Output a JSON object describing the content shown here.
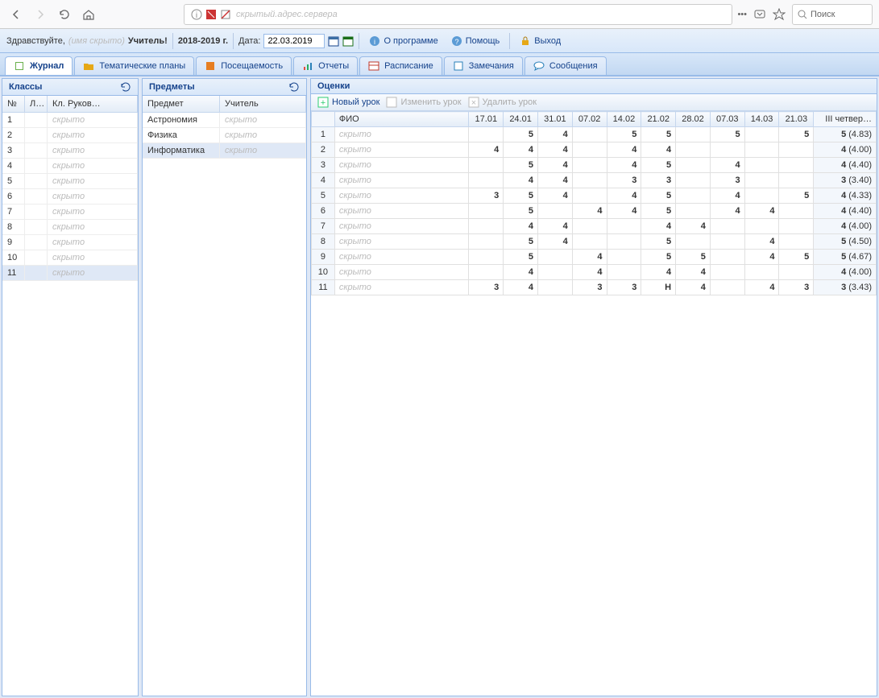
{
  "browser": {
    "url_display": "",
    "search_placeholder": "Поиск"
  },
  "toolbar": {
    "greeting": "Здравствуйте,",
    "user_placeholder": "(имя скрыто)",
    "role": "Учитель!",
    "year": "2018-2019 г.",
    "date_label": "Дата:",
    "date_value": "22.03.2019",
    "about": "О программе",
    "help": "Помощь",
    "exit": "Выход"
  },
  "tabs": [
    "Журнал",
    "Тематические планы",
    "Посещаемость",
    "Отчеты",
    "Расписание",
    "Замечания",
    "Сообщения"
  ],
  "classes_title": "Классы",
  "classes_headers": {
    "num": "№",
    "par": "Л…",
    "head": "Кл. Руков…"
  },
  "classes": [
    {
      "n": "1"
    },
    {
      "n": "2"
    },
    {
      "n": "3"
    },
    {
      "n": "4"
    },
    {
      "n": "5"
    },
    {
      "n": "6"
    },
    {
      "n": "7"
    },
    {
      "n": "8"
    },
    {
      "n": "9"
    },
    {
      "n": "10"
    },
    {
      "n": "11"
    }
  ],
  "subjects_title": "Предметы",
  "subjects_headers": {
    "subj": "Предмет",
    "teacher": "Учитель"
  },
  "subjects": [
    {
      "s": "Астрономия"
    },
    {
      "s": "Физика"
    },
    {
      "s": "Информатика"
    }
  ],
  "grades_title": "Оценки",
  "grades_toolbar": {
    "new": "Новый урок",
    "edit": "Изменить урок",
    "delete": "Удалить урок"
  },
  "grades_headers": {
    "fio": "ФИО",
    "dates": [
      "17.01",
      "24.01",
      "31.01",
      "07.02",
      "14.02",
      "21.02",
      "28.02",
      "07.03",
      "14.03",
      "21.03"
    ],
    "quarter": "III четвер…"
  },
  "grades_rows": [
    {
      "n": "1",
      "d": [
        "",
        "5",
        "4",
        "",
        "5",
        "5",
        "",
        "5",
        "",
        "5"
      ],
      "q": "5",
      "avg": "(4.83)"
    },
    {
      "n": "2",
      "d": [
        "4",
        "4",
        "4",
        "",
        "4",
        "4",
        "",
        "",
        "",
        ""
      ],
      "q": "4",
      "avg": "(4.00)"
    },
    {
      "n": "3",
      "d": [
        "",
        "5",
        "4",
        "",
        "4",
        "5",
        "",
        "4",
        "",
        ""
      ],
      "q": "4",
      "avg": "(4.40)"
    },
    {
      "n": "4",
      "d": [
        "",
        "4",
        "4",
        "",
        "3",
        "3",
        "",
        "3",
        "",
        ""
      ],
      "q": "3",
      "avg": "(3.40)"
    },
    {
      "n": "5",
      "d": [
        "3",
        "5",
        "4",
        "",
        "4",
        "5",
        "",
        "4",
        "",
        "5"
      ],
      "q": "4",
      "avg": "(4.33)"
    },
    {
      "n": "6",
      "d": [
        "",
        "5",
        "",
        "4",
        "4",
        "5",
        "",
        "4",
        "4",
        ""
      ],
      "q": "4",
      "avg": "(4.40)"
    },
    {
      "n": "7",
      "d": [
        "",
        "4",
        "4",
        "",
        "",
        "4",
        "4",
        "",
        "",
        ""
      ],
      "q": "4",
      "avg": "(4.00)"
    },
    {
      "n": "8",
      "d": [
        "",
        "5",
        "4",
        "",
        "",
        "5",
        "",
        "",
        "4",
        ""
      ],
      "q": "5",
      "avg": "(4.50)"
    },
    {
      "n": "9",
      "d": [
        "",
        "5",
        "",
        "4",
        "",
        "5",
        "5",
        "",
        "4",
        "5"
      ],
      "q": "5",
      "avg": "(4.67)"
    },
    {
      "n": "10",
      "d": [
        "",
        "4",
        "",
        "4",
        "",
        "4",
        "4",
        "",
        "",
        ""
      ],
      "q": "4",
      "avg": "(4.00)"
    },
    {
      "n": "11",
      "d": [
        "3",
        "4",
        "",
        "3",
        "3",
        "Н",
        "4",
        "",
        "4",
        "3"
      ],
      "q": "3",
      "avg": "(3.43)"
    }
  ]
}
